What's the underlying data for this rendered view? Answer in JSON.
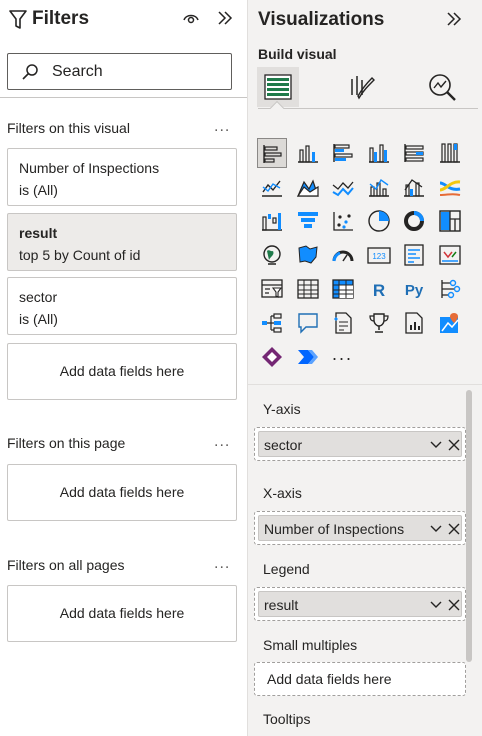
{
  "filters": {
    "title": "Filters",
    "search_placeholder": "Search",
    "on_visual": {
      "label": "Filters on this visual",
      "more": "...",
      "cards": [
        {
          "field": "Number of Inspections",
          "state": "is (All)"
        },
        {
          "field": "result",
          "state": "top 5 by Count of id"
        },
        {
          "field": "sector",
          "state": "is (All)"
        }
      ],
      "add": "Add data fields here"
    },
    "on_page": {
      "label": "Filters on this page",
      "more": "...",
      "add": "Add data fields here"
    },
    "on_all": {
      "label": "Filters on all pages",
      "more": "...",
      "add": "Add data fields here"
    }
  },
  "viz": {
    "title": "Visualizations",
    "build_visual": "Build visual",
    "more_visuals": "...",
    "icon_r": "R",
    "icon_py": "Py",
    "icon_123": "123",
    "wells": {
      "y_axis": {
        "label": "Y-axis",
        "field": "sector"
      },
      "x_axis": {
        "label": "X-axis",
        "field": "Number of Inspections"
      },
      "legend": {
        "label": "Legend",
        "field": "result"
      },
      "small_multiples": {
        "label": "Small multiples",
        "placeholder": "Add data fields here"
      },
      "tooltips": {
        "label": "Tooltips"
      }
    }
  },
  "colors": {
    "accent": "#118dff",
    "pane": "#f3f2f1",
    "selected": "#e1dfdd"
  }
}
